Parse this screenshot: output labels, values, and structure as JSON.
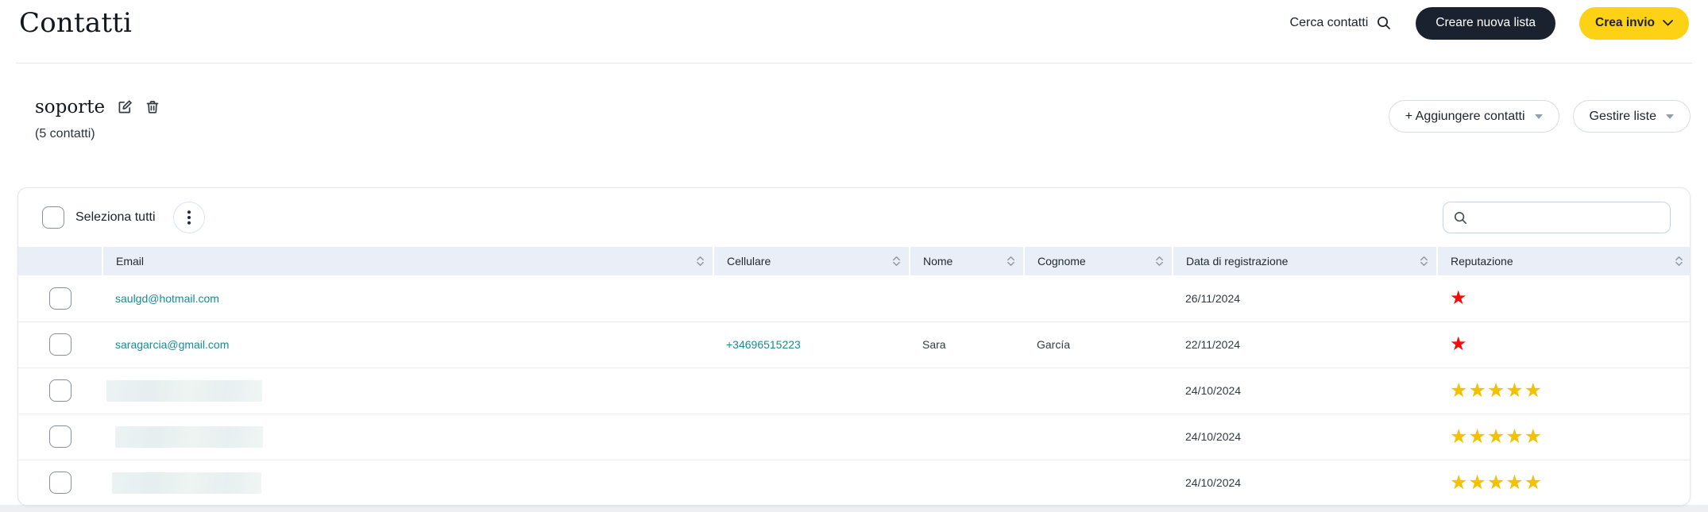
{
  "page": {
    "title": "Contatti"
  },
  "topbar": {
    "search_contacts_label": "Cerca contatti",
    "create_list_label": "Creare nuova lista",
    "create_send_label": "Crea invio"
  },
  "list": {
    "name": "soporte",
    "count_label": "(5 contatti)",
    "add_contacts_label": "+ Aggiungere contatti",
    "manage_lists_label": "Gestire liste"
  },
  "table": {
    "select_all_label": "Seleziona tutti",
    "search_placeholder": "",
    "columns": [
      "Email",
      "Cellulare",
      "Nome",
      "Cognome",
      "Data di registrazione",
      "Reputazione"
    ],
    "rows": [
      {
        "email": "saulgd@hotmail.com",
        "email_redacted": false,
        "cellulare": "",
        "nome": "",
        "cognome": "",
        "registration_date": "26/11/2024",
        "reputation_stars": 1,
        "reputation_color": "#f40b0b"
      },
      {
        "email": "saragarcia@gmail.com",
        "email_redacted": false,
        "cellulare": "+34696515223",
        "nome": "Sara",
        "cognome": "García",
        "registration_date": "22/11/2024",
        "reputation_stars": 1,
        "reputation_color": "#f40b0b"
      },
      {
        "email": "",
        "email_redacted": true,
        "cellulare": "",
        "nome": "",
        "cognome": "",
        "registration_date": "24/10/2024",
        "reputation_stars": 5,
        "reputation_color": "#f2c200"
      },
      {
        "email": "",
        "email_redacted": true,
        "cellulare": "",
        "nome": "",
        "cognome": "",
        "registration_date": "24/10/2024",
        "reputation_stars": 5,
        "reputation_color": "#f2c200"
      },
      {
        "email": "",
        "email_redacted": true,
        "cellulare": "",
        "nome": "",
        "cognome": "",
        "registration_date": "24/10/2024",
        "reputation_stars": 5,
        "reputation_color": "#f2c200"
      }
    ]
  },
  "colors": {
    "accent_yellow": "#fdd216",
    "dark_navy": "#1a2230",
    "link_teal": "#1b8a96",
    "star_red": "#f40b0b",
    "star_gold": "#f2c200",
    "header_bg": "#e9eef7"
  }
}
